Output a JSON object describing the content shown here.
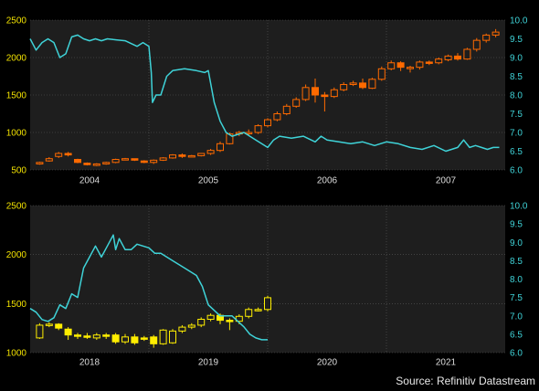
{
  "source": "Source: Refinitiv Datastream",
  "colors": {
    "background": "#000000",
    "panel": "#1e1e1e",
    "grid": "#5a5a5a",
    "line": "#3fd3d8",
    "candle_top": "#ff6a00",
    "candle_bottom": "#ffee00",
    "left_axis_text": "#f2e200",
    "right_axis_text": "#3fd3d8",
    "bottom_axis_text": "#dddddd"
  },
  "chart_data": [
    {
      "type": "line",
      "x_tick_labels": [
        "2004",
        "2005",
        "2006",
        "2007"
      ],
      "x_range": [
        2003.5,
        2007.5
      ],
      "y_left_ticks": [
        500,
        1000,
        1500,
        2000,
        2500
      ],
      "y_left_range": [
        500,
        2500
      ],
      "y_right_ticks": [
        6.0,
        6.5,
        7.0,
        7.5,
        8.0,
        8.5,
        9.0,
        9.5,
        10.0
      ],
      "y_right_range": [
        6.0,
        10.0
      ],
      "grid": true,
      "candles": {
        "axis": "left",
        "color": "#ff6a00",
        "x": [
          2003.58,
          2003.66,
          2003.74,
          2003.82,
          2003.9,
          2003.98,
          2004.06,
          2004.14,
          2004.22,
          2004.3,
          2004.38,
          2004.46,
          2004.54,
          2004.62,
          2004.7,
          2004.78,
          2004.86,
          2004.94,
          2005.02,
          2005.1,
          2005.18,
          2005.26,
          2005.34,
          2005.42,
          2005.5,
          2005.58,
          2005.66,
          2005.74,
          2005.82,
          2005.9,
          2005.98,
          2006.06,
          2006.14,
          2006.22,
          2006.3,
          2006.38,
          2006.46,
          2006.54,
          2006.62,
          2006.7,
          2006.78,
          2006.86,
          2006.94,
          2007.02,
          2007.1,
          2007.18,
          2007.26,
          2007.34,
          2007.42
        ],
        "open": [
          580,
          620,
          680,
          720,
          640,
          590,
          560,
          580,
          600,
          640,
          650,
          620,
          600,
          630,
          660,
          700,
          680,
          690,
          720,
          760,
          850,
          980,
          1000,
          1000,
          1090,
          1170,
          1250,
          1350,
          1440,
          1600,
          1500,
          1480,
          1570,
          1640,
          1660,
          1590,
          1710,
          1850,
          1930,
          1860,
          1870,
          1940,
          1930,
          1970,
          2020,
          1980,
          2110,
          2230,
          2300
        ],
        "close": [
          600,
          650,
          720,
          700,
          600,
          570,
          580,
          600,
          640,
          650,
          630,
          600,
          630,
          660,
          700,
          680,
          690,
          720,
          760,
          850,
          980,
          1000,
          1000,
          1090,
          1170,
          1250,
          1350,
          1440,
          1600,
          1500,
          1480,
          1570,
          1640,
          1660,
          1600,
          1710,
          1850,
          1930,
          1870,
          1870,
          1940,
          1930,
          1980,
          2020,
          1980,
          2110,
          2230,
          2300,
          2340
        ],
        "high": [
          610,
          670,
          740,
          740,
          650,
          600,
          590,
          610,
          650,
          660,
          650,
          630,
          640,
          670,
          710,
          720,
          700,
          720,
          780,
          880,
          1000,
          1020,
          1040,
          1110,
          1190,
          1280,
          1380,
          1470,
          1640,
          1720,
          1540,
          1600,
          1670,
          1690,
          1720,
          1730,
          1880,
          1960,
          1950,
          1890,
          1960,
          1960,
          2000,
          2040,
          2060,
          2130,
          2260,
          2320,
          2380
        ],
        "low": [
          570,
          610,
          660,
          680,
          590,
          560,
          550,
          570,
          590,
          630,
          620,
          590,
          580,
          620,
          650,
          660,
          670,
          680,
          700,
          740,
          840,
          950,
          960,
          980,
          1070,
          1150,
          1230,
          1330,
          1420,
          1400,
          1280,
          1460,
          1550,
          1620,
          1580,
          1580,
          1690,
          1830,
          1820,
          1800,
          1840,
          1900,
          1910,
          1950,
          1960,
          1970,
          2080,
          2200,
          2270
        ]
      },
      "series": [
        {
          "axis": "right",
          "color": "#3fd3d8",
          "x": [
            2003.5,
            2003.55,
            2003.6,
            2003.65,
            2003.7,
            2003.75,
            2003.8,
            2003.85,
            2003.9,
            2003.95,
            2004.0,
            2004.05,
            2004.1,
            2004.15,
            2004.2,
            2004.3,
            2004.4,
            2004.45,
            2004.5,
            2004.52,
            2004.53,
            2004.56,
            2004.6,
            2004.65,
            2004.7,
            2004.8,
            2004.9,
            2004.97,
            2005.0,
            2005.05,
            2005.1,
            2005.15,
            2005.2,
            2005.3,
            2005.4,
            2005.5,
            2005.55,
            2005.6,
            2005.7,
            2005.8,
            2005.9,
            2005.95,
            2006.0,
            2006.1,
            2006.2,
            2006.3,
            2006.4,
            2006.5,
            2006.6,
            2006.7,
            2006.8,
            2006.9,
            2007.0,
            2007.1,
            2007.15,
            2007.2,
            2007.25,
            2007.3,
            2007.35,
            2007.4,
            2007.45
          ],
          "values": [
            9.5,
            9.2,
            9.4,
            9.5,
            9.4,
            9.0,
            9.1,
            9.55,
            9.6,
            9.5,
            9.45,
            9.5,
            9.45,
            9.5,
            9.48,
            9.45,
            9.3,
            9.4,
            9.3,
            8.6,
            7.8,
            8.0,
            8.0,
            8.5,
            8.65,
            8.7,
            8.65,
            8.6,
            8.65,
            7.8,
            7.3,
            7.0,
            6.9,
            7.0,
            6.8,
            6.6,
            6.8,
            6.9,
            6.85,
            6.9,
            6.75,
            6.9,
            6.8,
            6.75,
            6.7,
            6.75,
            6.65,
            6.75,
            6.7,
            6.6,
            6.55,
            6.65,
            6.5,
            6.6,
            6.8,
            6.6,
            6.65,
            6.6,
            6.55,
            6.6,
            6.6
          ]
        }
      ]
    },
    {
      "type": "line",
      "x_tick_labels": [
        "2018",
        "2019",
        "2020",
        "2021"
      ],
      "x_range": [
        2017.5,
        2021.5
      ],
      "y_left_ticks": [
        1000,
        1500,
        2000,
        2500
      ],
      "y_left_range": [
        1000,
        2500
      ],
      "y_right_ticks": [
        6.0,
        6.5,
        7.0,
        7.5,
        8.0,
        8.5,
        9.0,
        9.5,
        10.0
      ],
      "y_right_range": [
        6.0,
        10.0
      ],
      "grid": true,
      "candles": {
        "axis": "left",
        "color": "#ffee00",
        "x": [
          2017.58,
          2017.66,
          2017.74,
          2017.82,
          2017.9,
          2017.98,
          2018.06,
          2018.14,
          2018.22,
          2018.3,
          2018.38,
          2018.46,
          2018.54,
          2018.62,
          2018.7,
          2018.78,
          2018.86,
          2018.94,
          2019.02,
          2019.1,
          2019.18,
          2019.26,
          2019.34,
          2019.42,
          2019.5
        ],
        "open": [
          1150,
          1280,
          1290,
          1240,
          1180,
          1170,
          1150,
          1180,
          1180,
          1110,
          1160,
          1150,
          1160,
          1090,
          1100,
          1220,
          1260,
          1280,
          1340,
          1380,
          1330,
          1320,
          1370,
          1440,
          1440
        ],
        "close": [
          1280,
          1290,
          1250,
          1180,
          1170,
          1160,
          1180,
          1170,
          1110,
          1160,
          1100,
          1140,
          1090,
          1230,
          1220,
          1260,
          1280,
          1340,
          1380,
          1330,
          1320,
          1370,
          1440,
          1440,
          1560
        ],
        "high": [
          1300,
          1310,
          1300,
          1260,
          1200,
          1200,
          1200,
          1200,
          1200,
          1190,
          1190,
          1170,
          1180,
          1240,
          1240,
          1280,
          1300,
          1360,
          1400,
          1400,
          1350,
          1390,
          1460,
          1460,
          1580
        ],
        "low": [
          1140,
          1260,
          1230,
          1130,
          1140,
          1140,
          1130,
          1140,
          1090,
          1090,
          1080,
          1120,
          1050,
          1080,
          1090,
          1200,
          1240,
          1260,
          1320,
          1290,
          1230,
          1290,
          1350,
          1420,
          1420
        ]
      },
      "series": [
        {
          "axis": "right",
          "color": "#3fd3d8",
          "x": [
            2017.5,
            2017.55,
            2017.6,
            2017.65,
            2017.7,
            2017.75,
            2017.8,
            2017.85,
            2017.9,
            2017.95,
            2018.0,
            2018.05,
            2018.1,
            2018.15,
            2018.2,
            2018.22,
            2018.25,
            2018.3,
            2018.35,
            2018.4,
            2018.45,
            2018.5,
            2018.55,
            2018.6,
            2018.7,
            2018.8,
            2018.9,
            2018.95,
            2019.0,
            2019.1,
            2019.2,
            2019.25,
            2019.3,
            2019.35,
            2019.4,
            2019.45,
            2019.5
          ],
          "values": [
            7.2,
            7.1,
            6.9,
            6.85,
            6.95,
            7.3,
            7.2,
            7.6,
            7.5,
            8.3,
            8.6,
            8.9,
            8.6,
            8.9,
            9.2,
            8.8,
            9.1,
            8.8,
            8.8,
            8.95,
            8.9,
            8.85,
            8.7,
            8.7,
            8.5,
            8.3,
            8.1,
            7.8,
            7.3,
            7.0,
            7.0,
            6.85,
            6.7,
            6.5,
            6.4,
            6.35,
            6.35
          ]
        }
      ]
    }
  ]
}
